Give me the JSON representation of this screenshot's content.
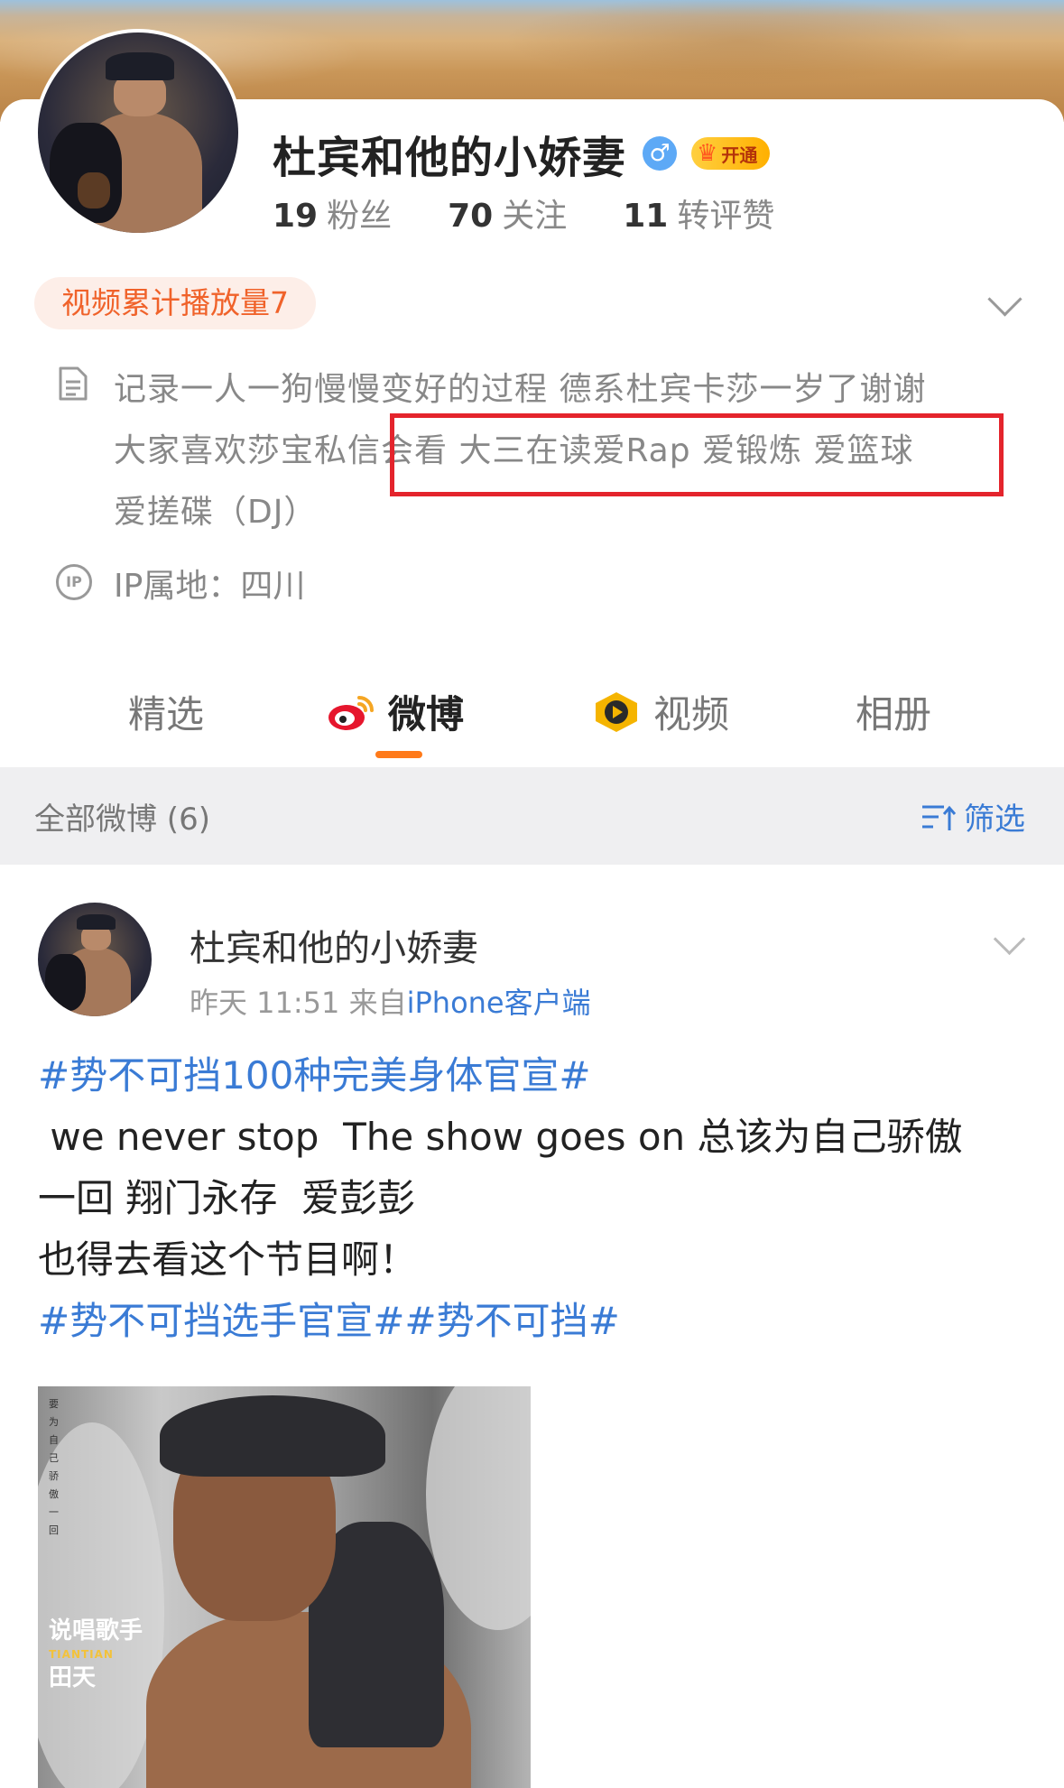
{
  "profile": {
    "username": "杜宾和他的小娇妻",
    "gender_symbol": "♂",
    "vip_label": "开通",
    "stats": [
      {
        "num": "19",
        "label": "粉丝"
      },
      {
        "num": "70",
        "label": "关注"
      },
      {
        "num": "11",
        "label": "转评赞"
      }
    ],
    "play_badge": "视频累计播放量7",
    "bio_lines": [
      "记录一人一狗慢慢变好的过程 德系杜宾卡莎一岁了谢谢",
      "大家喜欢莎宝私信会看 大三在读爱Rap 爱锻炼 爱篮球",
      "爱搓碟（DJ）"
    ],
    "ip_icon_text": "IP",
    "ip_location": "IP属地：四川"
  },
  "tabs": [
    {
      "label": "精选",
      "active": false
    },
    {
      "label": "微博",
      "active": true
    },
    {
      "label": "视频",
      "active": false
    },
    {
      "label": "相册",
      "active": false
    }
  ],
  "filter_bar": {
    "count_label": "全部微博 (6)",
    "filter_label": "筛选"
  },
  "post": {
    "author": "杜宾和他的小娇妻",
    "time": "昨天 11:51",
    "from_label": "来自",
    "client": "iPhone客户端",
    "hashtag1": "#势不可挡100种完美身体官宣#",
    "text_line1": " we never stop  The show goes on 总该为自己骄傲",
    "text_line2": "一回 翔门永存  爱彭彭",
    "text_line3": "也得去看这个节目啊！",
    "hashtag2": "#势不可挡选手官宣##势不可挡#",
    "image_vertical_text": "要为自己骄傲一回",
    "image_caption_main": "说唱歌手",
    "image_caption_en": "TIANTIAN",
    "image_caption_name": "田天"
  },
  "colors": {
    "accent_orange": "#ff7a1a",
    "link_blue": "#3a7bd5",
    "highlight_red": "#e4242c"
  }
}
